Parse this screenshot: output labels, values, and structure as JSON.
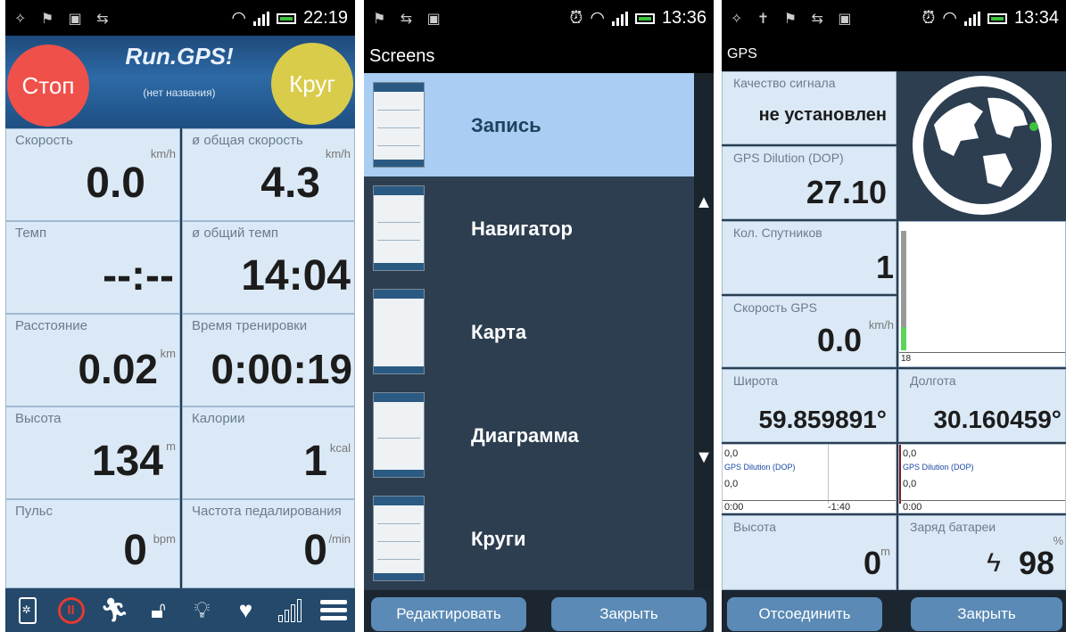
{
  "status1": {
    "time": "22:19"
  },
  "status2": {
    "time": "13:36"
  },
  "status3": {
    "time": "13:34"
  },
  "panel1": {
    "stop_label": "Стоп",
    "lap_label": "Круг",
    "brand": "Run.GPS!",
    "route_name": "(нет названия)",
    "cells": [
      {
        "label": "Скорость",
        "value": "0.0",
        "unit": "km/h"
      },
      {
        "label": "ø общая скорость",
        "value": "4.3",
        "unit": "km/h"
      },
      {
        "label": "Темп",
        "value": "--:--",
        "unit": ""
      },
      {
        "label": "ø общий темп",
        "value": "14:04",
        "unit": ""
      },
      {
        "label": "Расстояние",
        "value": "0.02",
        "unit": "km"
      },
      {
        "label": "Время тренировки",
        "value": "0:00:19",
        "unit": ""
      },
      {
        "label": "Высота",
        "value": "134",
        "unit": "m"
      },
      {
        "label": "Калории",
        "value": "1",
        "unit": "kcal"
      },
      {
        "label": "Пульс",
        "value": "0",
        "unit": "bpm"
      },
      {
        "label": "Частота педалирования",
        "value": "0",
        "unit": "/min"
      }
    ],
    "toolbar_icons": [
      "phone-settings-icon",
      "pause-icon",
      "runner-icon",
      "unlock-icon",
      "bulb-icon",
      "heart-icon",
      "signal-bars-icon",
      "menu-icon"
    ]
  },
  "panel2": {
    "title": "Screens",
    "screens": [
      {
        "name": "Запись",
        "selected": true
      },
      {
        "name": "Навигатор",
        "selected": false
      },
      {
        "name": "Карта",
        "selected": false
      },
      {
        "name": "Диаграмма",
        "selected": false
      },
      {
        "name": "Круги",
        "selected": false
      }
    ],
    "edit_label": "Редактировать",
    "close_label": "Закрыть"
  },
  "panel3": {
    "title": "GPS",
    "signal_label": "Качество сигнала",
    "signal_value": "не установлен",
    "dop_label": "GPS Dilution (DOP)",
    "dop_value": "27.10",
    "sat_label": "Кол. Спутников",
    "sat_value": "1",
    "gps_speed_label": "Скорость GPS",
    "gps_speed_value": "0.0",
    "gps_speed_unit": "km/h",
    "sat_axis_label": "18",
    "lat_label": "Широта",
    "lat_value": "59.859891°",
    "lon_label": "Долгота",
    "lon_value": "30.160459°",
    "mini_left": {
      "top": "0,0",
      "series": "GPS Dilution (DOP)",
      "mid": "0,0",
      "x_start": "0:00",
      "x_end": "-1:40"
    },
    "mini_right": {
      "top": "0,0",
      "series": "GPS Dilution (DOP)",
      "mid": "0,0",
      "x_start": "0:00"
    },
    "alt_label": "Высота",
    "alt_value": "0",
    "alt_unit": "m",
    "battery_label": "Заряд батареи",
    "battery_value": "98",
    "battery_unit": "%",
    "disconnect_label": "Отсоединить",
    "close_label": "Закрыть"
  }
}
